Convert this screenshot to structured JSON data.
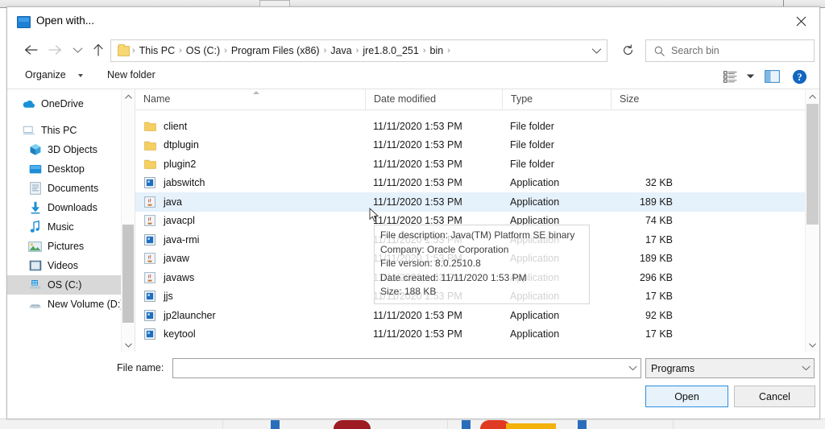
{
  "window": {
    "title": "Open with...",
    "title_icon": "monitor-icon",
    "close_label": "Close"
  },
  "nav": {
    "back_icon": "arrow-left-icon",
    "forward_icon": "arrow-right-icon",
    "recent_icon": "chevron-down-icon",
    "up_icon": "arrow-up-icon",
    "refresh_icon": "refresh-icon",
    "address_caret_icon": "chevron-down-icon",
    "folder_icon": "folder-icon",
    "breadcrumbs": [
      "This PC",
      "OS (C:)",
      "Program Files (x86)",
      "Java",
      "jre1.8.0_251",
      "bin"
    ],
    "separator": "›"
  },
  "search": {
    "placeholder": "Search bin",
    "icon": "search-icon"
  },
  "commandbar": {
    "organize": "Organize",
    "new_folder": "New folder",
    "view_icon": "view-list-icon",
    "view_caret_icon": "chevron-down-icon",
    "preview_pane_icon": "preview-pane-icon",
    "help_icon": "help-icon"
  },
  "sidebar": {
    "items": [
      {
        "label": "OneDrive",
        "icon": "onedrive-cloud-icon",
        "indent": false,
        "selected": false
      },
      {
        "label": "This PC",
        "icon": "this-pc-icon",
        "indent": false,
        "selected": false
      },
      {
        "label": "3D Objects",
        "icon": "3d-objects-icon",
        "indent": true,
        "selected": false
      },
      {
        "label": "Desktop",
        "icon": "desktop-icon",
        "indent": true,
        "selected": false
      },
      {
        "label": "Documents",
        "icon": "documents-icon",
        "indent": true,
        "selected": false
      },
      {
        "label": "Downloads",
        "icon": "downloads-icon",
        "indent": true,
        "selected": false
      },
      {
        "label": "Music",
        "icon": "music-note-icon",
        "indent": true,
        "selected": false
      },
      {
        "label": "Pictures",
        "icon": "pictures-icon",
        "indent": true,
        "selected": false
      },
      {
        "label": "Videos",
        "icon": "videos-icon",
        "indent": true,
        "selected": false
      },
      {
        "label": "OS (C:)",
        "icon": "hard-drive-icon",
        "indent": true,
        "selected": true
      },
      {
        "label": "New Volume (D:)",
        "icon": "disk-drive-icon",
        "indent": true,
        "selected": false
      }
    ]
  },
  "filelist": {
    "columns": [
      "Name",
      "Date modified",
      "Type",
      "Size"
    ],
    "sort_column": "Name",
    "rows": [
      {
        "name": "client",
        "date": "11/11/2020 1:53 PM",
        "type": "File folder",
        "size": "",
        "icon": "folder-icon",
        "selected": false
      },
      {
        "name": "dtplugin",
        "date": "11/11/2020 1:53 PM",
        "type": "File folder",
        "size": "",
        "icon": "folder-icon",
        "selected": false
      },
      {
        "name": "plugin2",
        "date": "11/11/2020 1:53 PM",
        "type": "File folder",
        "size": "",
        "icon": "folder-icon",
        "selected": false
      },
      {
        "name": "jabswitch",
        "date": "11/11/2020 1:53 PM",
        "type": "Application",
        "size": "32 KB",
        "icon": "exe-blue-icon",
        "selected": false
      },
      {
        "name": "java",
        "date": "11/11/2020 1:53 PM",
        "type": "Application",
        "size": "189 KB",
        "icon": "java-coffee-icon",
        "selected": true
      },
      {
        "name": "javacpl",
        "date": "11/11/2020 1:53 PM",
        "type": "Application",
        "size": "74 KB",
        "icon": "java-coffee-icon",
        "selected": false
      },
      {
        "name": "java-rmi",
        "date": "11/11/2020 1:53 PM",
        "type": "Application",
        "size": "17 KB",
        "icon": "exe-blue-icon",
        "selected": false
      },
      {
        "name": "javaw",
        "date": "11/11/2020 1:53 PM",
        "type": "Application",
        "size": "189 KB",
        "icon": "java-coffee-icon",
        "selected": false
      },
      {
        "name": "javaws",
        "date": "11/11/2020 1:53 PM",
        "type": "Application",
        "size": "296 KB",
        "icon": "java-coffee-icon",
        "selected": false
      },
      {
        "name": "jjs",
        "date": "11/11/2020 1:53 PM",
        "type": "Application",
        "size": "17 KB",
        "icon": "exe-blue-icon",
        "selected": false
      },
      {
        "name": "jp2launcher",
        "date": "11/11/2020 1:53 PM",
        "type": "Application",
        "size": "92 KB",
        "icon": "exe-blue-icon",
        "selected": false
      },
      {
        "name": "keytool",
        "date": "11/11/2020 1:53 PM",
        "type": "Application",
        "size": "17 KB",
        "icon": "exe-blue-icon",
        "selected": false
      }
    ]
  },
  "tooltip": {
    "lines": [
      "File description: Java(TM) Platform SE binary",
      "Company: Oracle Corporation",
      "File version: 8.0.2510.8",
      "Date created: 11/11/2020 1:53 PM",
      "Size: 188 KB"
    ]
  },
  "footer": {
    "filename_label": "File name:",
    "filename_value": "",
    "filename_caret_icon": "chevron-down-icon",
    "filter_value": "Programs",
    "filter_caret_icon": "chevron-down-icon",
    "open_label": "Open",
    "cancel_label": "Cancel"
  },
  "colors": {
    "accent": "#2a8fe0",
    "selection": "#e5f1fb",
    "sidebar_selection": "#d8d8d8",
    "folder_yellow": "#f8d775"
  }
}
